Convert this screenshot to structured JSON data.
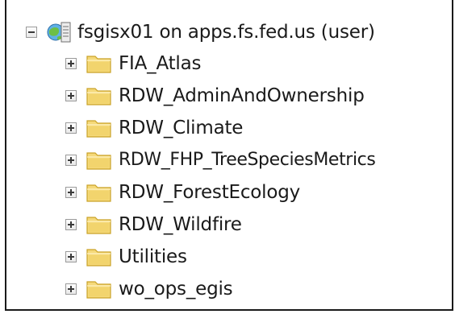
{
  "tree": {
    "root": {
      "label": "fsgisx01 on apps.fs.fed.us (user)",
      "expanded": true,
      "icon": "server-connection-icon"
    },
    "items": [
      {
        "label": "FIA_Atlas",
        "icon": "folder-icon"
      },
      {
        "label": "RDW_AdminAndOwnership",
        "icon": "folder-icon"
      },
      {
        "label": "RDW_Climate",
        "icon": "folder-icon"
      },
      {
        "label": "RDW_FHP_TreeSpeciesMetrics",
        "icon": "folder-icon"
      },
      {
        "label": "RDW_ForestEcology",
        "icon": "folder-icon"
      },
      {
        "label": "RDW_Wildfire",
        "icon": "folder-icon"
      },
      {
        "label": "Utilities",
        "icon": "folder-icon"
      },
      {
        "label": "wo_ops_egis",
        "icon": "folder-icon"
      }
    ]
  },
  "colors": {
    "folder_fill": "#f5d97a",
    "folder_edge": "#c9a227",
    "text": "#1a1a1a"
  }
}
